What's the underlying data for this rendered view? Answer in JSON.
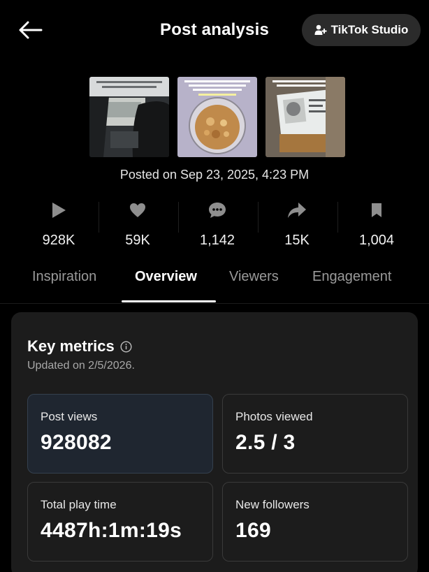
{
  "header": {
    "title": "Post analysis",
    "studio_button_label": "TikTok Studio"
  },
  "post": {
    "posted_on": "Posted on Sep 23, 2025, 4:23 PM",
    "thumbnails": [
      {
        "caption": "car interior"
      },
      {
        "caption": "bowl of cat food"
      },
      {
        "caption": "cat food package"
      }
    ]
  },
  "stats": [
    {
      "icon": "play-icon",
      "value": "928K"
    },
    {
      "icon": "heart-icon",
      "value": "59K"
    },
    {
      "icon": "comment-icon",
      "value": "1,142"
    },
    {
      "icon": "share-icon",
      "value": "15K"
    },
    {
      "icon": "bookmark-icon",
      "value": "1,004"
    }
  ],
  "tabs": [
    {
      "label": "Inspiration",
      "active": false
    },
    {
      "label": "Overview",
      "active": true
    },
    {
      "label": "Viewers",
      "active": false
    },
    {
      "label": "Engagement",
      "active": false
    }
  ],
  "key_metrics": {
    "title": "Key metrics",
    "updated": "Updated on 2/5/2026.",
    "cards": [
      {
        "label": "Post views",
        "value": "928082",
        "selected": true
      },
      {
        "label": "Photos viewed",
        "value": "2.5 / 3",
        "selected": false
      },
      {
        "label": "Total play time",
        "value": "4487h:1m:19s",
        "selected": false
      },
      {
        "label": "New followers",
        "value": "169",
        "selected": false
      }
    ]
  },
  "colors": {
    "background": "#000000",
    "panel": "#1c1c1c",
    "selected_card": "#1f2630",
    "muted_text": "#9a9a9a"
  }
}
